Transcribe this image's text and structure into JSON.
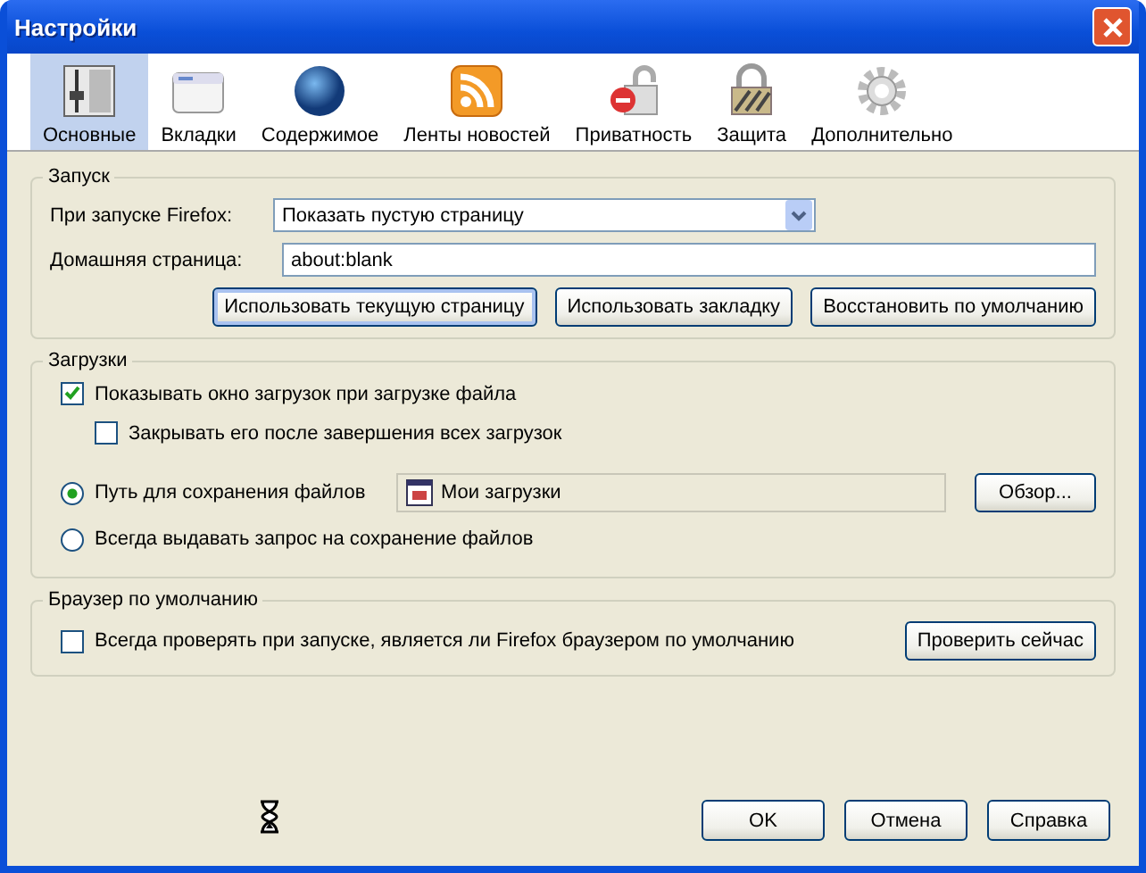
{
  "window": {
    "title": "Настройки"
  },
  "tabs": [
    {
      "label": "Основные",
      "kind": "general",
      "selected": true
    },
    {
      "label": "Вкладки",
      "kind": "tabs",
      "selected": false
    },
    {
      "label": "Содержимое",
      "kind": "content",
      "selected": false
    },
    {
      "label": "Ленты новостей",
      "kind": "feeds",
      "selected": false
    },
    {
      "label": "Приватность",
      "kind": "privacy",
      "selected": false
    },
    {
      "label": "Защита",
      "kind": "security",
      "selected": false
    },
    {
      "label": "Дополнительно",
      "kind": "advanced",
      "selected": false
    }
  ],
  "startup": {
    "title": "Запуск",
    "when_label": "При запуске Firefox:",
    "when_value": "Показать пустую страницу",
    "home_label": "Домашняя страница:",
    "home_value": "about:blank",
    "buttons": [
      {
        "label": "Использовать текущую страницу",
        "focused": true
      },
      {
        "label": "Использовать закладку",
        "focused": false
      },
      {
        "label": "Восстановить по умолчанию",
        "focused": false
      }
    ]
  },
  "downloads": {
    "title": "Загрузки",
    "show_window": {
      "label": "Показывать окно загрузок при загрузке файла",
      "checked": true
    },
    "close_after": {
      "label": "Закрывать его после завершения всех загрузок",
      "checked": false
    },
    "save_options": [
      {
        "label": "Путь для сохранения файлов",
        "selected": true,
        "folder": "Мои загрузки",
        "button": "Обзор..."
      },
      {
        "label": "Всегда выдавать запрос на сохранение файлов",
        "selected": false
      }
    ]
  },
  "default_browser": {
    "title": "Браузер по умолчанию",
    "check": {
      "label": "Всегда проверять при запуске, является ли Firefox браузером по умолчанию",
      "checked": false
    },
    "button": "Проверить сейчас"
  },
  "buttons": [
    "OK",
    "Отмена",
    "Справка"
  ]
}
